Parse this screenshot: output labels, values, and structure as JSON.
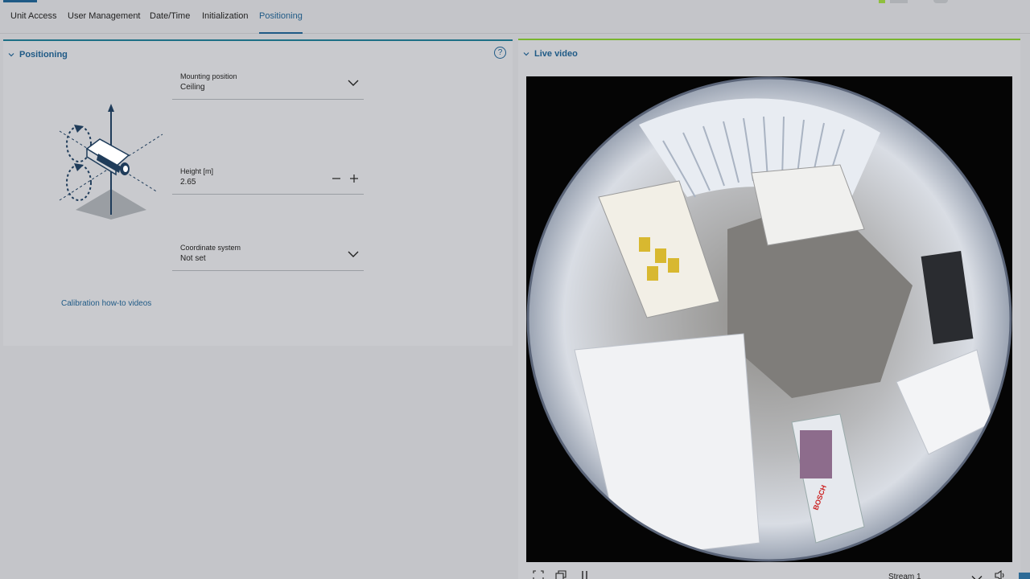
{
  "tabs": [
    {
      "label": "Unit Access"
    },
    {
      "label": "User Management"
    },
    {
      "label": "Date/Time"
    },
    {
      "label": "Initialization"
    },
    {
      "label": "Positioning"
    }
  ],
  "active_tab": "Positioning",
  "positioning": {
    "title": "Positioning",
    "help_symbol": "?",
    "mounting_label": "Mounting position",
    "mounting_value": "Ceiling",
    "height_label": "Height [m]",
    "height_value": "2.65",
    "coordinate_label": "Coordinate system",
    "coordinate_value": "Not set",
    "calibration_link": "Calibration how-to videos"
  },
  "live_video": {
    "title": "Live video",
    "stream_value": "Stream 1",
    "poster_text": "BOSCH"
  },
  "colors": {
    "accent_blue": "#1f5a86",
    "accent_teal": "#1e6f86",
    "accent_green": "#79b52f"
  }
}
